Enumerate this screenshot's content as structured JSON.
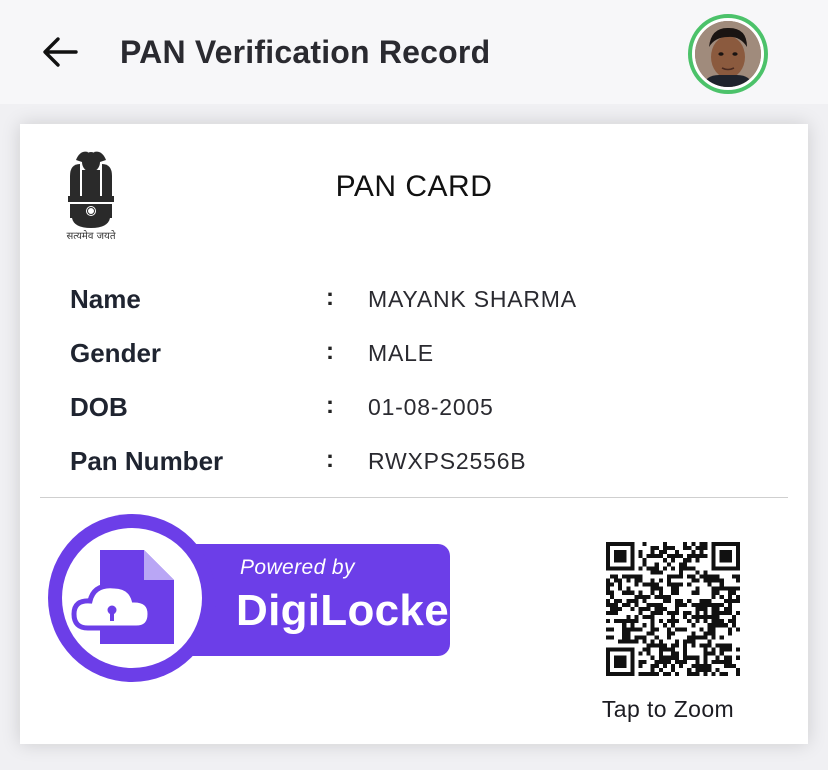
{
  "header": {
    "title": "PAN Verification Record",
    "back_icon": "arrow-left-icon",
    "avatar_border_color": "#4cc26a"
  },
  "card": {
    "title": "PAN CARD",
    "emblem_motto": "सत्यमेव जयते",
    "fields": [
      {
        "label": "Name",
        "separator": ":",
        "value": "MAYANK SHARMA"
      },
      {
        "label": "Gender",
        "separator": ":",
        "value": "MALE"
      },
      {
        "label": "DOB",
        "separator": ":",
        "value": "01-08-2005"
      },
      {
        "label": "Pan Number",
        "separator": ":",
        "value": "RWXPS2556B"
      }
    ]
  },
  "badge": {
    "powered_by": "Powered by",
    "brand": "DigiLocker",
    "color": "#6c3ee8"
  },
  "qr": {
    "caption": "Tap to Zoom"
  }
}
